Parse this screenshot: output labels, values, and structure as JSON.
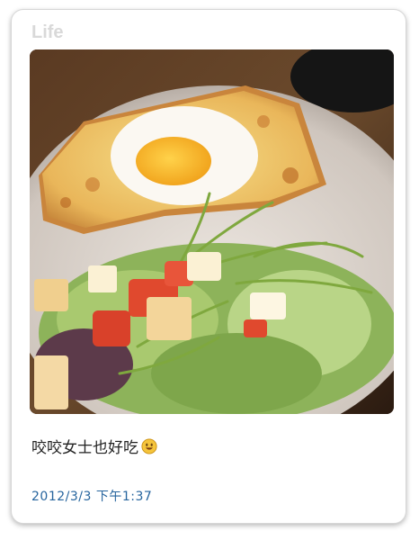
{
  "header": {
    "title": "Life"
  },
  "post": {
    "photo_alt": "Croque madame with a fried egg and side salad",
    "caption": "咬咬女士也好吃",
    "caption_emoji": "smiling-face-icon",
    "timestamp": "2012/3/3 下午1:37"
  },
  "colors": {
    "title": "#d9d9d9",
    "caption": "#222222",
    "timestamp": "#27659e",
    "card_border": "#d7d7d7"
  }
}
